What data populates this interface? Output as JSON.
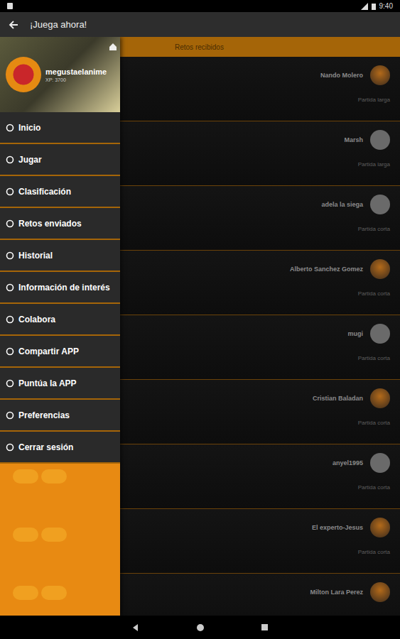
{
  "status_bar": {
    "time": "9:40"
  },
  "app_bar": {
    "title": "¡Juega ahora!"
  },
  "drawer": {
    "username": "megustaelanime",
    "xp": "XP: 3700",
    "items": [
      {
        "label": "Inicio"
      },
      {
        "label": "Jugar"
      },
      {
        "label": "Clasificación"
      },
      {
        "label": "Retos enviados"
      },
      {
        "label": "Historial"
      },
      {
        "label": "Información de interés"
      },
      {
        "label": "Colabora"
      },
      {
        "label": "Compartir APP"
      },
      {
        "label": "Puntúa la APP"
      },
      {
        "label": "Preferencias"
      },
      {
        "label": "Cerrar sesión"
      }
    ]
  },
  "list": {
    "title": "Retos recibidos",
    "rows": [
      {
        "name": "Nando Molero",
        "mode": "Partida larga",
        "kind": "photo"
      },
      {
        "name": "Marsh",
        "mode": "Partida larga",
        "kind": "default"
      },
      {
        "name": "adela la siega",
        "mode": "Partida corta",
        "kind": "default"
      },
      {
        "name": "Alberto Sanchez Gomez",
        "mode": "Partida corta",
        "kind": "photo"
      },
      {
        "name": "mugi",
        "mode": "Partida corta",
        "kind": "default"
      },
      {
        "name": "Cristian Baladan",
        "mode": "Partida corta",
        "kind": "photo"
      },
      {
        "name": "anyel1995",
        "mode": "Partida corta",
        "kind": "default"
      },
      {
        "name": "El experto-Jesus",
        "mode": "Partida corta",
        "kind": "photo"
      },
      {
        "name": "Milton Lara Perez",
        "kind": "photo"
      }
    ]
  }
}
